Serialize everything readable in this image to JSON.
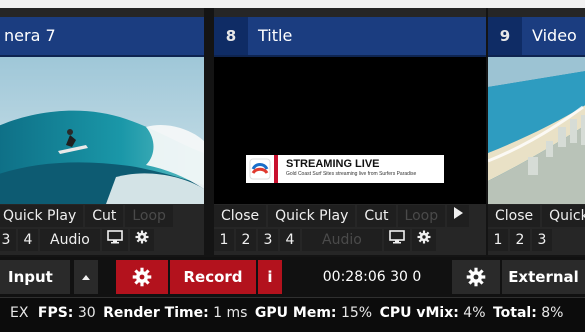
{
  "panels": [
    {
      "number": "",
      "title": "nera 7",
      "row1": [
        "Quick Play",
        "Cut",
        "Loop"
      ],
      "row2": [
        "3",
        "4",
        "Audio"
      ]
    },
    {
      "number": "8",
      "title": "Title",
      "overlay": {
        "headline": "STREAMING LIVE",
        "subline": "Gold Coast Surf Sites streaming live from Surfers Paradise"
      },
      "row1": [
        "Close",
        "Quick Play",
        "Cut",
        "Loop"
      ],
      "row2": [
        "1",
        "2",
        "3",
        "4",
        "Audio"
      ]
    },
    {
      "number": "9",
      "title": "Video",
      "row1": [
        "Close",
        "Quick"
      ],
      "row2": [
        "1",
        "2",
        "3"
      ]
    }
  ],
  "bottom_bar": {
    "input_label": "Input",
    "record_label": "Record",
    "info_label": "i",
    "timecode": "00:28:06 30 0",
    "external_label": "External"
  },
  "status": {
    "lead": "EX",
    "fps_label": "FPS:",
    "fps_value": "30",
    "render_label": "Render Time:",
    "render_value": "1 ms",
    "gpu_label": "GPU Mem:",
    "gpu_value": "15%",
    "cpu_label": "CPU vMix:",
    "cpu_value": "4%",
    "total_label": "Total:",
    "total_value": "8%"
  },
  "colors": {
    "title_bar": "#1b3d80",
    "record_red": "#b3121d",
    "panel_bg": "#262626"
  },
  "icons": {
    "settings": "gear-icon",
    "monitor": "monitor-icon",
    "play": "play-icon",
    "dropdown": "caret-up-icon"
  }
}
